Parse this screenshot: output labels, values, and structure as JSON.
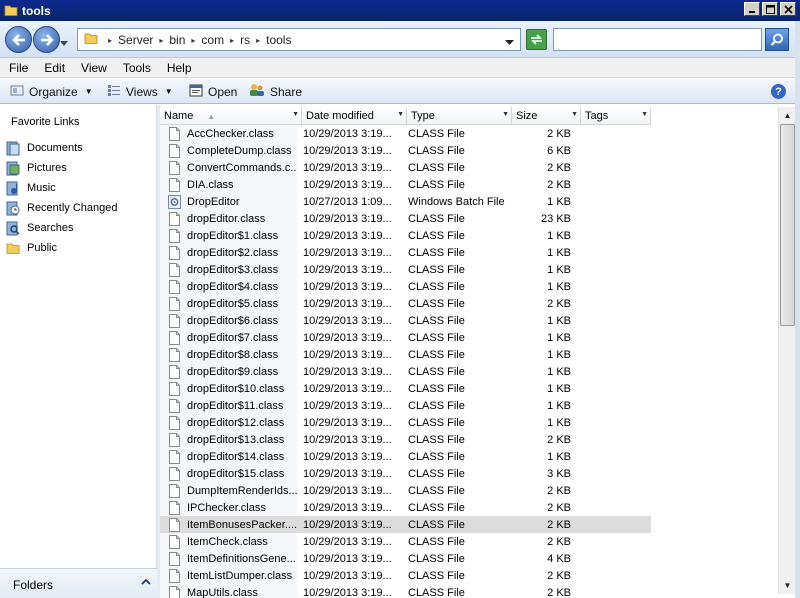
{
  "window": {
    "title": "tools"
  },
  "address": {
    "crumbs": [
      "Server",
      "bin",
      "com",
      "rs",
      "tools"
    ]
  },
  "search": {
    "value": "",
    "placeholder": ""
  },
  "menu": [
    "File",
    "Edit",
    "View",
    "Tools",
    "Help"
  ],
  "commands": {
    "organize": "Organize",
    "views": "Views",
    "open": "Open",
    "share": "Share"
  },
  "nav": {
    "header": "Favorite Links",
    "items": [
      {
        "label": "Documents",
        "icon": "documents-icon"
      },
      {
        "label": "Pictures",
        "icon": "pictures-icon"
      },
      {
        "label": "Music",
        "icon": "music-icon"
      },
      {
        "label": "Recently Changed",
        "icon": "recently-changed-icon"
      },
      {
        "label": "Searches",
        "icon": "searches-icon"
      },
      {
        "label": "Public",
        "icon": "folder-icon"
      }
    ],
    "folders_label": "Folders"
  },
  "columns": [
    "Name",
    "Date modified",
    "Type",
    "Size",
    "Tags"
  ],
  "files": [
    {
      "name": "AccChecker.class",
      "date": "10/29/2013 3:19...",
      "type": "CLASS File",
      "size": "2 KB",
      "icon": "file"
    },
    {
      "name": "CompleteDump.class",
      "date": "10/29/2013 3:19...",
      "type": "CLASS File",
      "size": "6 KB",
      "icon": "file"
    },
    {
      "name": "ConvertCommands.c...",
      "date": "10/29/2013 3:19...",
      "type": "CLASS File",
      "size": "2 KB",
      "icon": "file"
    },
    {
      "name": "DIA.class",
      "date": "10/29/2013 3:19...",
      "type": "CLASS File",
      "size": "2 KB",
      "icon": "file"
    },
    {
      "name": "DropEditor",
      "date": "10/27/2013 1:09...",
      "type": "Windows Batch File",
      "size": "1 KB",
      "icon": "batch"
    },
    {
      "name": "dropEditor.class",
      "date": "10/29/2013 3:19...",
      "type": "CLASS File",
      "size": "23 KB",
      "icon": "file"
    },
    {
      "name": "dropEditor$1.class",
      "date": "10/29/2013 3:19...",
      "type": "CLASS File",
      "size": "1 KB",
      "icon": "file"
    },
    {
      "name": "dropEditor$2.class",
      "date": "10/29/2013 3:19...",
      "type": "CLASS File",
      "size": "1 KB",
      "icon": "file"
    },
    {
      "name": "dropEditor$3.class",
      "date": "10/29/2013 3:19...",
      "type": "CLASS File",
      "size": "1 KB",
      "icon": "file"
    },
    {
      "name": "dropEditor$4.class",
      "date": "10/29/2013 3:19...",
      "type": "CLASS File",
      "size": "1 KB",
      "icon": "file"
    },
    {
      "name": "dropEditor$5.class",
      "date": "10/29/2013 3:19...",
      "type": "CLASS File",
      "size": "2 KB",
      "icon": "file"
    },
    {
      "name": "dropEditor$6.class",
      "date": "10/29/2013 3:19...",
      "type": "CLASS File",
      "size": "1 KB",
      "icon": "file"
    },
    {
      "name": "dropEditor$7.class",
      "date": "10/29/2013 3:19...",
      "type": "CLASS File",
      "size": "1 KB",
      "icon": "file"
    },
    {
      "name": "dropEditor$8.class",
      "date": "10/29/2013 3:19...",
      "type": "CLASS File",
      "size": "1 KB",
      "icon": "file"
    },
    {
      "name": "dropEditor$9.class",
      "date": "10/29/2013 3:19...",
      "type": "CLASS File",
      "size": "1 KB",
      "icon": "file"
    },
    {
      "name": "dropEditor$10.class",
      "date": "10/29/2013 3:19...",
      "type": "CLASS File",
      "size": "1 KB",
      "icon": "file"
    },
    {
      "name": "dropEditor$11.class",
      "date": "10/29/2013 3:19...",
      "type": "CLASS File",
      "size": "1 KB",
      "icon": "file"
    },
    {
      "name": "dropEditor$12.class",
      "date": "10/29/2013 3:19...",
      "type": "CLASS File",
      "size": "1 KB",
      "icon": "file"
    },
    {
      "name": "dropEditor$13.class",
      "date": "10/29/2013 3:19...",
      "type": "CLASS File",
      "size": "2 KB",
      "icon": "file"
    },
    {
      "name": "dropEditor$14.class",
      "date": "10/29/2013 3:19...",
      "type": "CLASS File",
      "size": "1 KB",
      "icon": "file"
    },
    {
      "name": "dropEditor$15.class",
      "date": "10/29/2013 3:19...",
      "type": "CLASS File",
      "size": "3 KB",
      "icon": "file"
    },
    {
      "name": "DumpItemRenderIds...",
      "date": "10/29/2013 3:19...",
      "type": "CLASS File",
      "size": "2 KB",
      "icon": "file"
    },
    {
      "name": "IPChecker.class",
      "date": "10/29/2013 3:19...",
      "type": "CLASS File",
      "size": "2 KB",
      "icon": "file"
    },
    {
      "name": "ItemBonusesPacker....",
      "date": "10/29/2013 3:19...",
      "type": "CLASS File",
      "size": "2 KB",
      "icon": "file",
      "selected": true
    },
    {
      "name": "ItemCheck.class",
      "date": "10/29/2013 3:19...",
      "type": "CLASS File",
      "size": "2 KB",
      "icon": "file"
    },
    {
      "name": "ItemDefinitionsGene...",
      "date": "10/29/2013 3:19...",
      "type": "CLASS File",
      "size": "4 KB",
      "icon": "file"
    },
    {
      "name": "ItemListDumper.class",
      "date": "10/29/2013 3:19...",
      "type": "CLASS File",
      "size": "2 KB",
      "icon": "file"
    },
    {
      "name": "MapUtils.class",
      "date": "10/29/2013 3:19...",
      "type": "CLASS File",
      "size": "2 KB",
      "icon": "file"
    }
  ]
}
